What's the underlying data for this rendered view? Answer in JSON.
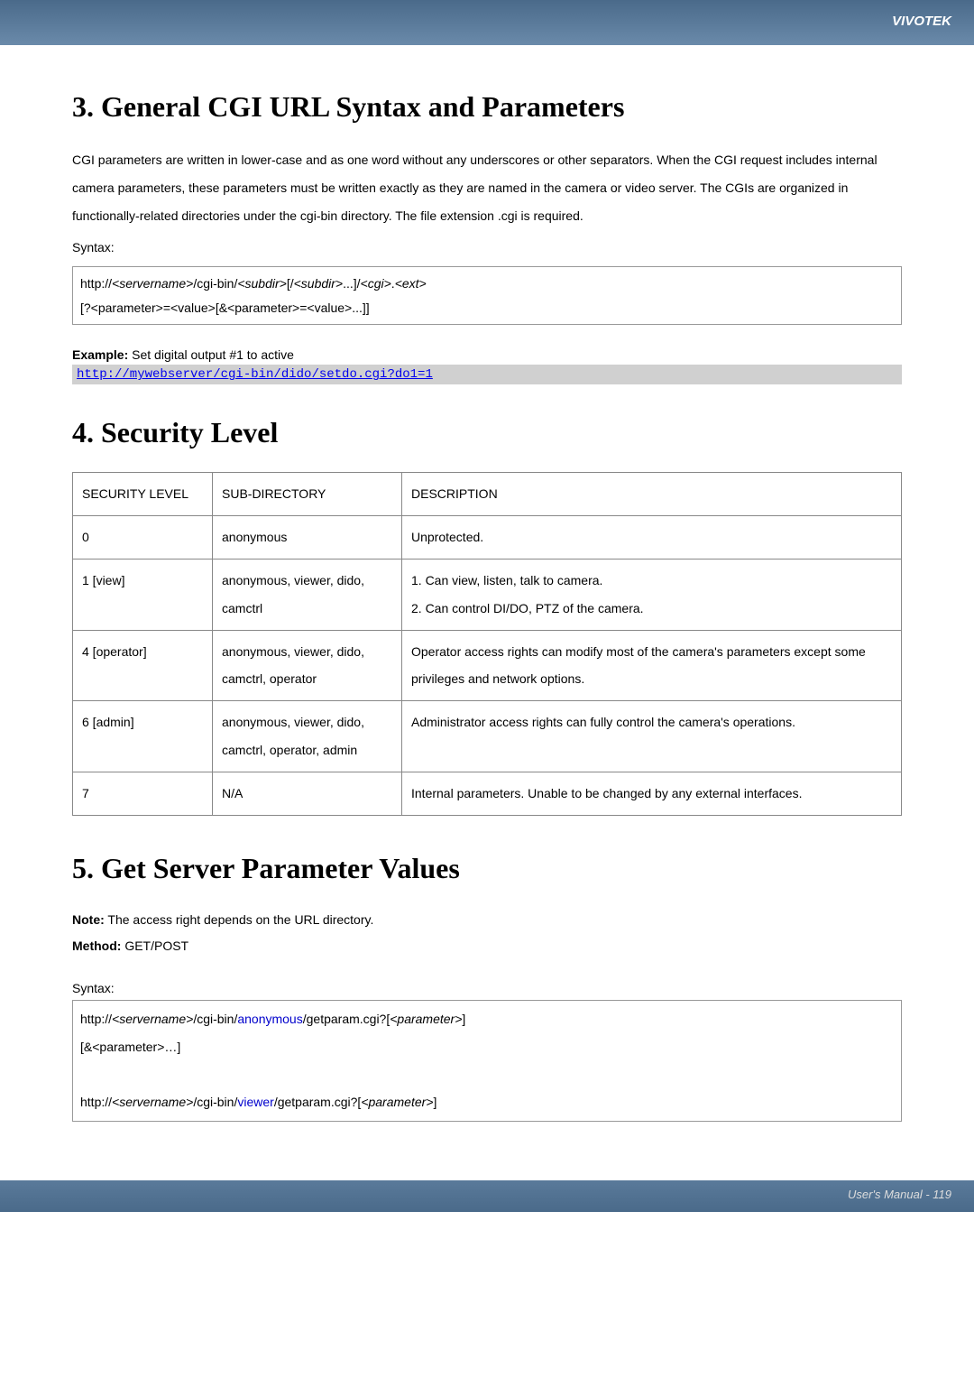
{
  "header": {
    "brand": "VIVOTEK"
  },
  "section3": {
    "title": "3. General CGI URL Syntax and Parameters",
    "body": "CGI parameters are written in lower-case and as one word without any underscores or other separators. When the CGI request includes internal camera parameters, these parameters must be written exactly as they are named in the camera or video server. The CGIs are organized in functionally-related directories under the cgi-bin directory. The file extension .cgi is required.",
    "syntax_label": "Syntax:",
    "syntax_line1_a": "http://",
    "syntax_line1_b": "<servername>",
    "syntax_line1_c": "/cgi-bin/",
    "syntax_line1_d": "<subdir>",
    "syntax_line1_e": "[/",
    "syntax_line1_f": "<subdir>",
    "syntax_line1_g": "...]/",
    "syntax_line1_h": "<cgi>",
    "syntax_line1_i": ".",
    "syntax_line1_j": "<ext>",
    "syntax_line2": "[?<parameter>=<value>[&<parameter>=<value>...]]",
    "example_label": "Example:",
    "example_text": " Set digital output #1 to active",
    "example_url": "http://mywebserver/cgi-bin/dido/setdo.cgi?do1=1"
  },
  "section4": {
    "title": "4. Security Level",
    "headers": [
      "SECURITY LEVEL",
      "SUB-DIRECTORY",
      "DESCRIPTION"
    ],
    "rows": [
      {
        "level": "0",
        "subdir": "anonymous",
        "desc": "Unprotected."
      },
      {
        "level": "1 [view]",
        "subdir": "anonymous, viewer, dido, camctrl",
        "desc": "1. Can view, listen, talk to camera.\n2. Can control DI/DO, PTZ of the camera."
      },
      {
        "level": "4 [operator]",
        "subdir": "anonymous, viewer, dido, camctrl, operator",
        "desc": "Operator access rights can modify most of the camera's parameters except some privileges and network options."
      },
      {
        "level": "6 [admin]",
        "subdir": "anonymous, viewer, dido, camctrl, operator, admin",
        "desc": "Administrator access rights can fully control the camera's operations."
      },
      {
        "level": "7",
        "subdir": "N/A",
        "desc": "Internal parameters. Unable to be changed by any external interfaces."
      }
    ]
  },
  "section5": {
    "title": "5. Get Server Parameter Values",
    "note_label": "Note:",
    "note_text": " The access right depends on the URL directory.",
    "method_label": "Method:",
    "method_text": " GET/POST",
    "syntax_label": "Syntax:",
    "s1_a": "http://",
    "s1_b": "<servername>",
    "s1_c": "/cgi-bin/",
    "s1_d": "anonymous",
    "s1_e": "/getparam.cgi?[",
    "s1_f": "<parameter>",
    "s1_g": "]",
    "s2": "[&<parameter>…]",
    "s3_a": "http://",
    "s3_b": "<servername>",
    "s3_c": "/cgi-bin/",
    "s3_d": "viewer",
    "s3_e": "/getparam.cgi?[",
    "s3_f": "<parameter>",
    "s3_g": "]"
  },
  "footer": {
    "text": "User's Manual - 119"
  }
}
